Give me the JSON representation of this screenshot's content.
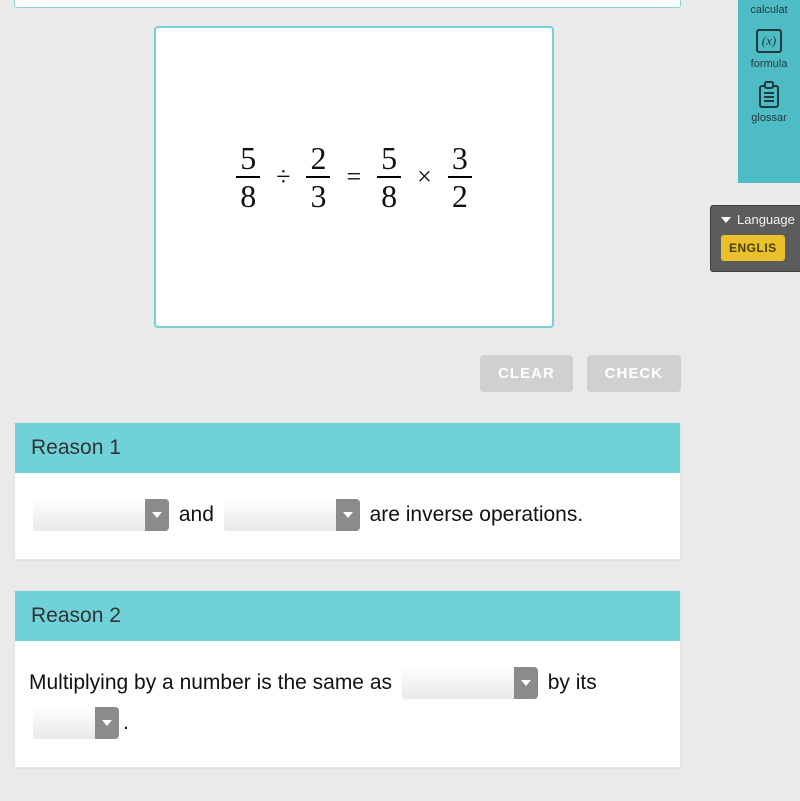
{
  "equation": {
    "left": {
      "num": "5",
      "den": "8"
    },
    "op1": "÷",
    "mid": {
      "num": "2",
      "den": "3"
    },
    "eq": "=",
    "right1": {
      "num": "5",
      "den": "8"
    },
    "op2": "×",
    "right2": {
      "num": "3",
      "den": "2"
    }
  },
  "tools": {
    "calculator_label": "calculat",
    "formulas_label": "formula",
    "glossary_label": "glossar"
  },
  "language": {
    "header": "Language",
    "selected": "ENGLIS"
  },
  "actions": {
    "clear": "CLEAR",
    "check": "CHECK"
  },
  "reason1": {
    "title": "Reason 1",
    "text_mid": "and",
    "text_tail": "are inverse operations."
  },
  "reason2": {
    "title": "Reason 2",
    "text_a": "Multiplying by a number is the same as",
    "text_b": "by its",
    "text_c": "."
  }
}
